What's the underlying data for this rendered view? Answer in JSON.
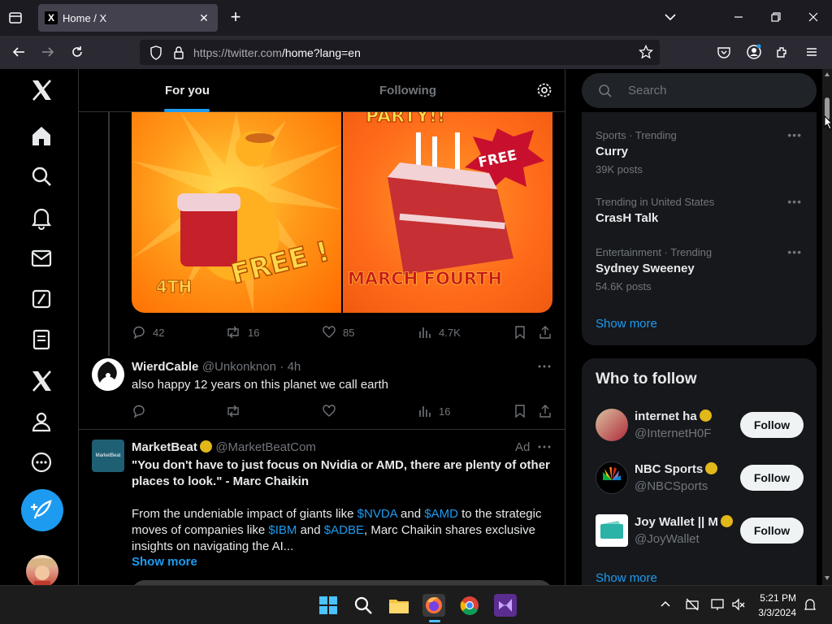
{
  "browser": {
    "tab_title": "Home / X",
    "url_host": "https://twitter.com",
    "url_path": "/home?lang=en"
  },
  "feed": {
    "tabs": [
      "For you",
      "Following"
    ],
    "image_texts": {
      "left_free": "FREE !",
      "left_bottom": "4TH",
      "right_top": "PARTY!!",
      "right_free": "FREE",
      "right_bottom": "MARCH FOURTH"
    },
    "tweet1_stats": {
      "replies": "42",
      "reposts": "16",
      "likes": "85",
      "views": "4.7K"
    },
    "tweet2": {
      "name": "WierdCable",
      "handle": "@Unkonknon",
      "time": "· 4h",
      "text": "also happy 12 years on this planet we call earth",
      "views": "16"
    },
    "tweet3": {
      "name": "MarketBeat",
      "handle": "@MarketBeatCom",
      "ad_label": "Ad",
      "avatar_text": "MarketBeat",
      "quote": "\"You don't have to just focus on Nvidia or AMD, there are plenty of other places to look.\" - Marc Chaikin",
      "p1": "From the undeniable impact of giants like ",
      "t1": "$NVDA",
      "p2": " and ",
      "t2": "$AMD",
      "p3": " to the strategic moves of companies like ",
      "t3": "$IBM",
      "p4": " and ",
      "t4": "$ADBE",
      "p5": ", Marc Chaikin shares exclusive insights on navigating the AI...",
      "show_more": "Show more"
    }
  },
  "sidebar_right": {
    "search_placeholder": "Search",
    "trends": [
      {
        "meta": "Sports · Trending",
        "name": "Curry",
        "count": "39K posts"
      },
      {
        "meta": "Trending in United States",
        "name": "CrasH Talk",
        "count": ""
      },
      {
        "meta": "Entertainment · Trending",
        "name": "Sydney Sweeney",
        "count": "54.6K posts"
      }
    ],
    "trends_show_more": "Show more",
    "who_to_follow_title": "Who to follow",
    "who": [
      {
        "name": "internet ha",
        "handle": "@InternetH0F",
        "button": "Follow"
      },
      {
        "name": "NBC Sports",
        "handle": "@NBCSports",
        "button": "Follow"
      },
      {
        "name": "Joy Wallet || M",
        "handle": "@JoyWallet",
        "button": "Follow"
      }
    ],
    "who_show_more": "Show more"
  },
  "taskbar": {
    "time": "5:21 PM",
    "date": "3/3/2024"
  },
  "colors": {
    "accent": "#1d9bf0",
    "background": "#000000",
    "muted": "#71767b"
  }
}
